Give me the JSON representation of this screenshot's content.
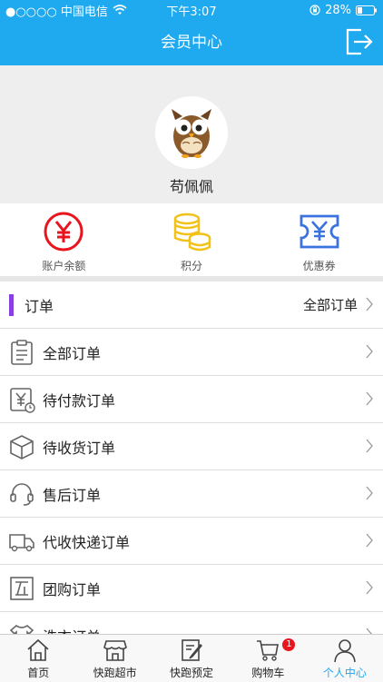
{
  "status_bar": {
    "carrier": "●○○○○ 中国电信",
    "time": "下午3:07",
    "battery": "28%",
    "icons": [
      "wifi-icon",
      "orientation-lock-icon",
      "battery-icon"
    ]
  },
  "nav": {
    "title": "会员中心",
    "logout_icon": "logout-icon"
  },
  "profile": {
    "username": "苟佩佩",
    "avatar_icon": "owl-avatar"
  },
  "wallet": [
    {
      "label": "账户余额",
      "icon": "yuan-circle-icon",
      "color": "#e8141e"
    },
    {
      "label": "积分",
      "icon": "coins-stack-icon",
      "color": "#f2c21b"
    },
    {
      "label": "优惠券",
      "icon": "coupon-icon",
      "color": "#3b72e0"
    }
  ],
  "orders": {
    "header_label": "订单",
    "header_link": "全部订单",
    "accent_color": "#8a3fe0",
    "items": [
      {
        "label": "全部订单",
        "icon": "clipboard-icon"
      },
      {
        "label": "待付款订单",
        "icon": "payment-pending-icon"
      },
      {
        "label": "待收货订单",
        "icon": "package-icon"
      },
      {
        "label": "售后订单",
        "icon": "headset-icon"
      },
      {
        "label": "代收快递订单",
        "icon": "delivery-truck-icon"
      },
      {
        "label": "团购订单",
        "icon": "group-buy-icon"
      },
      {
        "label": "洗衣订单",
        "icon": "laundry-icon"
      }
    ]
  },
  "tabbar": {
    "items": [
      {
        "label": "首页",
        "icon": "home-icon"
      },
      {
        "label": "快跑超市",
        "icon": "store-icon"
      },
      {
        "label": "快跑预定",
        "icon": "edit-icon"
      },
      {
        "label": "购物车",
        "icon": "cart-icon",
        "badge": "1"
      },
      {
        "label": "个人中心",
        "icon": "person-icon",
        "active": true
      }
    ],
    "active_color": "#1fa9ef"
  },
  "brand_color": "#1fa9ef"
}
